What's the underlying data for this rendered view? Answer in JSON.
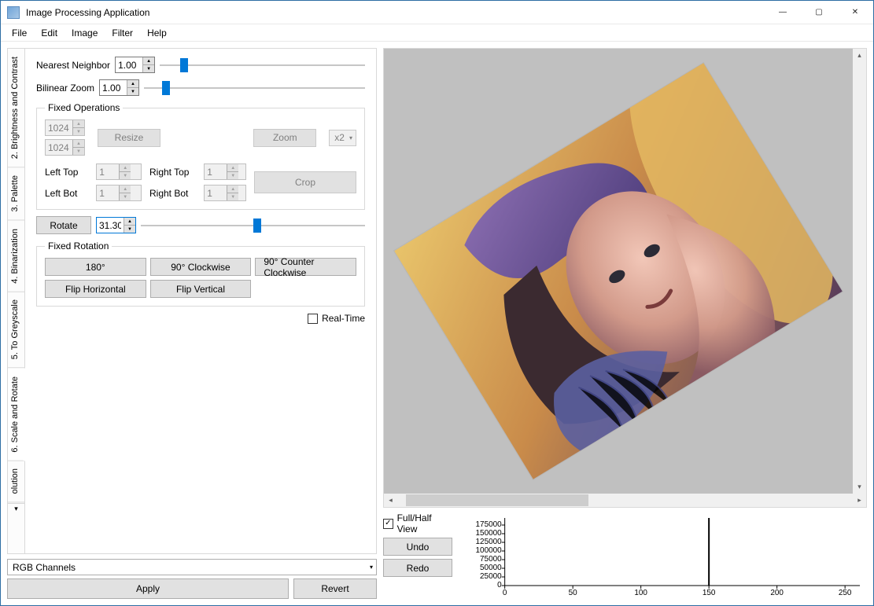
{
  "window": {
    "title": "Image Processing Application",
    "min": "—",
    "max": "▢",
    "close": "✕"
  },
  "menu": [
    "File",
    "Edit",
    "Image",
    "Filter",
    "Help"
  ],
  "tabs": {
    "extra": "olution",
    "list": [
      "2. Brightness and Contrast",
      "3. Palette",
      "4. Binarization",
      "5. To Greyscale",
      "6. Scale and Rotate"
    ],
    "active_index": 4
  },
  "scale_rotate": {
    "nn_label": "Nearest Neighbor",
    "nn_value": "1.00",
    "nn_slider_pos": 12,
    "bilinear_label": "Bilinear Zoom",
    "bilinear_value": "1.00",
    "bilinear_slider_pos": 10,
    "fixed_ops": {
      "legend": "Fixed Operations",
      "width": "1024",
      "height": "1024",
      "resize_label": "Resize",
      "zoom_label": "Zoom",
      "zoom_factor": "x2",
      "crop_label": "Crop",
      "lt_label": "Left Top",
      "lt_val": "1",
      "rt_label": "Right Top",
      "rt_val": "1",
      "lb_label": "Left Bot",
      "lb_val": "1",
      "rb_label": "Right Bot",
      "rb_val": "1"
    },
    "rotate_label": "Rotate",
    "rotate_value": "31.30",
    "rotate_slider_pos": 52,
    "fixed_rot": {
      "legend": "Fixed Rotation",
      "b180": "180°",
      "b90cw": "90° Clockwise",
      "b90ccw": "90° Counter Clockwise",
      "flip_h": "Flip Horizontal",
      "flip_v": "Flip Vertical"
    },
    "realtime_label": "Real-Time",
    "realtime_checked": false
  },
  "footer": {
    "channel_selector": "RGB Channels",
    "apply": "Apply",
    "revert": "Revert"
  },
  "rightpanel": {
    "full_half": "Full/Half View",
    "full_half_checked": true,
    "undo": "Undo",
    "redo": "Redo"
  },
  "chart_data": {
    "type": "bar",
    "title": "",
    "xlabel": "",
    "ylabel": "",
    "xlim": [
      0,
      260
    ],
    "ylim": [
      0,
      175000
    ],
    "x_ticks": [
      0,
      50,
      100,
      150,
      200,
      250
    ],
    "y_ticks": [
      0,
      25000,
      50000,
      75000,
      100000,
      125000,
      150000,
      175000
    ],
    "categories": [
      150
    ],
    "values": [
      175000
    ]
  }
}
